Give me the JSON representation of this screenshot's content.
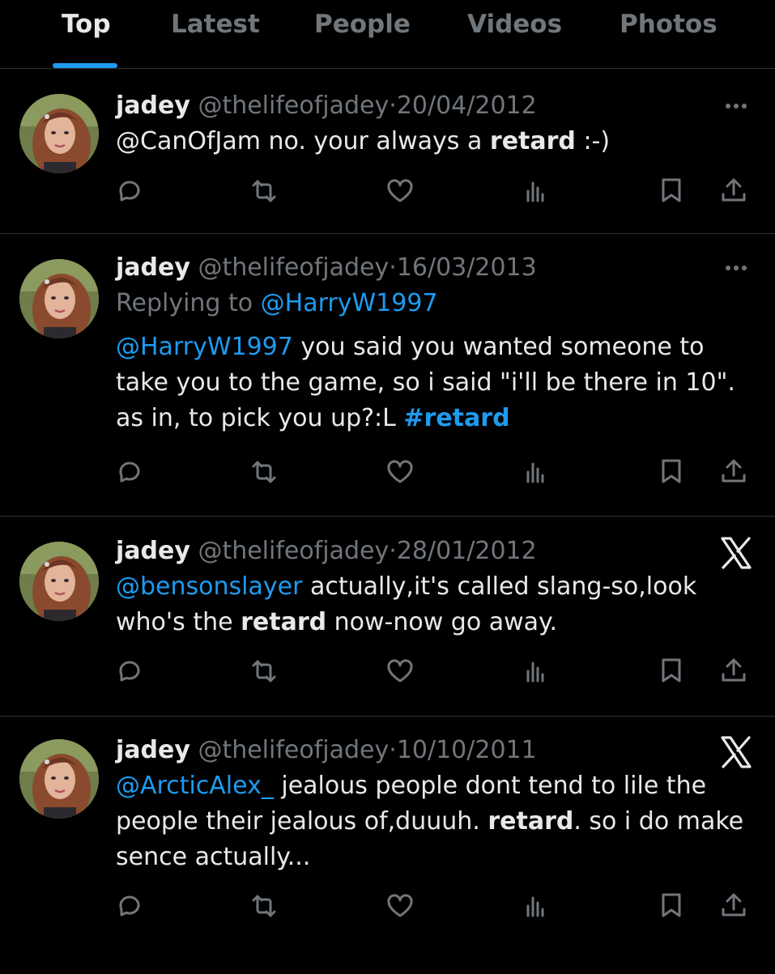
{
  "tabs": [
    {
      "label": "Top",
      "active": true
    },
    {
      "label": "Latest",
      "active": false
    },
    {
      "label": "People",
      "active": false
    },
    {
      "label": "Videos",
      "active": false
    },
    {
      "label": "Photos",
      "active": false
    }
  ],
  "colors": {
    "accent": "#1d9bf0",
    "background": "#000000",
    "muted": "#71767b",
    "text": "#e7e9ea"
  },
  "tweets": [
    {
      "name": "jadey",
      "handle": "@thelifeofjadey",
      "separator": "·",
      "date": "20/04/2012",
      "corner_icon": "more-icon",
      "text": {
        "p1_link": "",
        "p1": "@CanOfJam no. your always a ",
        "bold": "retard",
        "p2": " :-)",
        "hashtag": ""
      }
    },
    {
      "name": "jadey",
      "handle": "@thelifeofjadey",
      "separator": "·",
      "date": "16/03/2013",
      "corner_icon": "more-icon",
      "replying_label": "Replying to ",
      "replying_to": "@HarryW1997",
      "text": {
        "p1_link": "@HarryW1997",
        "p1": " you said you wanted someone to take you to the game, so i said \"i'll be there in 10\". as in, to pick you up?:L  ",
        "bold": "",
        "p2": "",
        "hashtag": "#retard"
      }
    },
    {
      "name": "jadey",
      "handle": "@thelifeofjadey",
      "separator": "·",
      "date": "28/01/2012",
      "corner_icon": "x-logo-icon",
      "text": {
        "p1_link": "@bensonslayer",
        "p1": " actually,it's called slang-so,look who's the ",
        "bold": "retard",
        "p2": " now-now go away.",
        "hashtag": ""
      }
    },
    {
      "name": "jadey",
      "handle": "@thelifeofjadey",
      "separator": "·",
      "date": "10/10/2011",
      "corner_icon": "x-logo-icon",
      "text": {
        "p1_link": "@ArcticAlex_",
        "p1": " jealous people dont tend to lile the people their jealous of,duuuh. ",
        "bold": "retard",
        "p2": ". so i do make sence actually...",
        "hashtag": ""
      }
    }
  ],
  "action_icons": [
    "reply-icon",
    "retweet-icon",
    "like-icon",
    "views-icon",
    "bookmark-icon",
    "share-icon"
  ]
}
